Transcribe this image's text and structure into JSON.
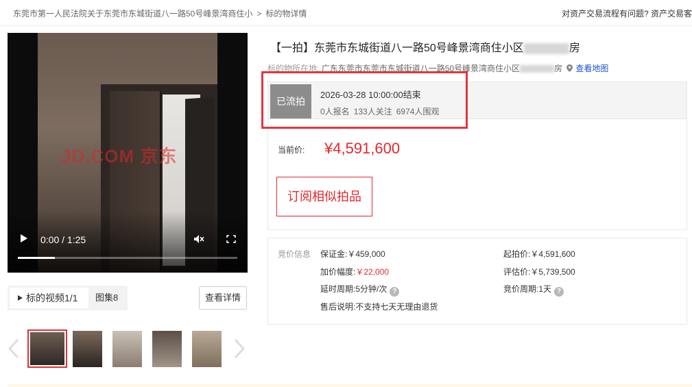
{
  "breadcrumb": {
    "link": "东莞市第一人民法院关于东莞市东城街道八一路50号峰景湾商住小",
    "separator": ">",
    "current": "标的物详情",
    "help_text": "对资产交易流程有问题? 资产交易客"
  },
  "video": {
    "watermark": "JD.COM 京东",
    "time": "0:00 / 1:25",
    "progress": 0.17
  },
  "media_tabs": {
    "video_label": "标的视频1/1",
    "gallery_label": "图集8",
    "detail_button": "查看详情"
  },
  "thumbnails": {
    "count": 5,
    "selected": 0
  },
  "listing": {
    "title_prefix": "【一拍】东莞市东城街道八一路50号峰景湾商住小区",
    "title_suffix": "房",
    "location_label": "标的物所在地:",
    "location_value": "广东东莞市东莞市东城街道八一路50号峰景湾商住小区",
    "location_suffix": "房",
    "map_link": "查看地图"
  },
  "auction_status": {
    "badge": "已流拍",
    "end_time": "2026-03-28 10:00:00结束",
    "registered": "0人报名",
    "followers": "133人关注",
    "viewers": "6974人围观"
  },
  "price": {
    "label": "当前价:",
    "value": "¥4,591,600"
  },
  "subscribe_button": "订阅相似拍品",
  "bid_info": {
    "section_label": "竞价信息",
    "deposit": "保证金:￥459,000",
    "increment_label": "加价幅度:",
    "increment_value": "￥22,000",
    "delay": "延时周期:5分钟/次",
    "after_sale": "售后说明:不支持七天无理由退货",
    "start_price": "起拍价:￥4,591,600",
    "appraisal": "评估价:￥5,739,500",
    "cycle": "竞价周期:1天"
  },
  "colors": {
    "accent_red": "#e4262b",
    "status_gray": "#8c8c8c",
    "link_blue": "#1a56c8"
  }
}
